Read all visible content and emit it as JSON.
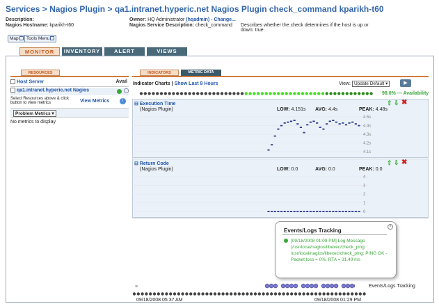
{
  "breadcrumb": {
    "services": "Services",
    "plugin": "Nagios Plugin",
    "title": "qa1.intranet.hyperic.net Nagios Plugin check_command kparikh-t60",
    "sep": ">"
  },
  "info": {
    "description_label": "Description:",
    "hostname_label": "Nagios Hostname:",
    "hostname_value": "kparikh-t60",
    "owner_label": "Owner:",
    "owner_value": "HQ Administrator",
    "owner_link": "(hqadmin) - Change...",
    "svc_desc_label": "Nagios Service Description:",
    "svc_desc_value": "check_command",
    "note": "Describes whether the check determines if the host is up or down: true"
  },
  "buttons": {
    "map": "Map",
    "tools_menu": "Tools Menu"
  },
  "tabs": [
    "MONITOR",
    "INVENTORY",
    "ALERT",
    "VIEWS"
  ],
  "left": {
    "resources_tab": "RESOURCES",
    "host_server_label": "Host Server",
    "avail_label": "Avail",
    "host_link": "qa1.intranet.hyperic.net Nagios",
    "select_note": "Select Resources above & click button to view metrics",
    "view_metrics": "View Metrics",
    "dropdown": "Problem Metrics",
    "no_metrics": "No metrics to display"
  },
  "right": {
    "indicators_tab": "INDICATORS",
    "metric_data_tab": "METRIC DATA",
    "indicator_charts": "Indicator Charts",
    "sep": "|",
    "show_last": "Show Last 8 Hours",
    "view_label": "View:",
    "view_select": "Update Default",
    "availability": "98.0% — Availability"
  },
  "chart_data": [
    {
      "type": "scatter",
      "title": "Execution Time",
      "subtitle": "(Nagios Plugin)",
      "low_label": "LOW:",
      "low": "4.151s",
      "avg_label": "AVG:",
      "avg": "4.4s",
      "peak_label": "PEAK:",
      "peak": "4.48s",
      "yticks": [
        "4.5s",
        "4.4s",
        "4.3s",
        "4.2s",
        "4.1s"
      ],
      "ylim": [
        4.1,
        4.5
      ],
      "values": [
        4.12,
        4.18,
        4.28,
        4.36,
        4.4,
        4.43,
        4.44,
        4.45,
        4.46,
        4.42,
        4.38,
        4.32,
        4.41,
        4.44,
        4.45,
        4.43,
        4.38,
        4.36,
        4.42,
        4.45,
        4.46,
        4.44,
        4.42,
        4.43,
        4.41,
        4.43,
        4.44,
        4.42,
        4.4
      ]
    },
    {
      "type": "scatter",
      "title": "Return Code",
      "subtitle": "(Nagios Plugin)",
      "low_label": "LOW:",
      "low": "0.0",
      "avg_label": "AVG:",
      "avg": "0.0",
      "peak_label": "PEAK:",
      "peak": "0.0",
      "yticks": [
        "4",
        "3",
        "2",
        "1",
        "0"
      ],
      "ylim": [
        0,
        4
      ],
      "values": [
        0,
        0,
        0,
        0,
        0,
        0,
        0,
        0,
        0,
        0,
        0,
        0,
        0,
        0,
        0,
        0,
        0,
        0,
        0,
        0,
        0,
        0,
        0,
        0,
        0,
        0,
        0,
        0,
        0
      ]
    }
  ],
  "events": {
    "title": "Events/Logs Tracking",
    "entry_time": "[09/18/2008 01:09 PM]",
    "entry_text": "Log Message (/usr/local/nagios/libexec/check_ping: /usr/local/nagios/libexec/check_ping: PING OK - Packet loss = 0%, RTA = 31.49 ms",
    "footer_label": "Events/Logs Tracking",
    "start_time": "09/18/2008 05:37 AM",
    "end_time": "09/18/2008 01:29 PM"
  },
  "colors": {
    "title_blue": "#3366aa",
    "accent_orange": "#d27a3c",
    "avail_green": "#33cc33",
    "dark_tab": "#4a6a7a"
  }
}
